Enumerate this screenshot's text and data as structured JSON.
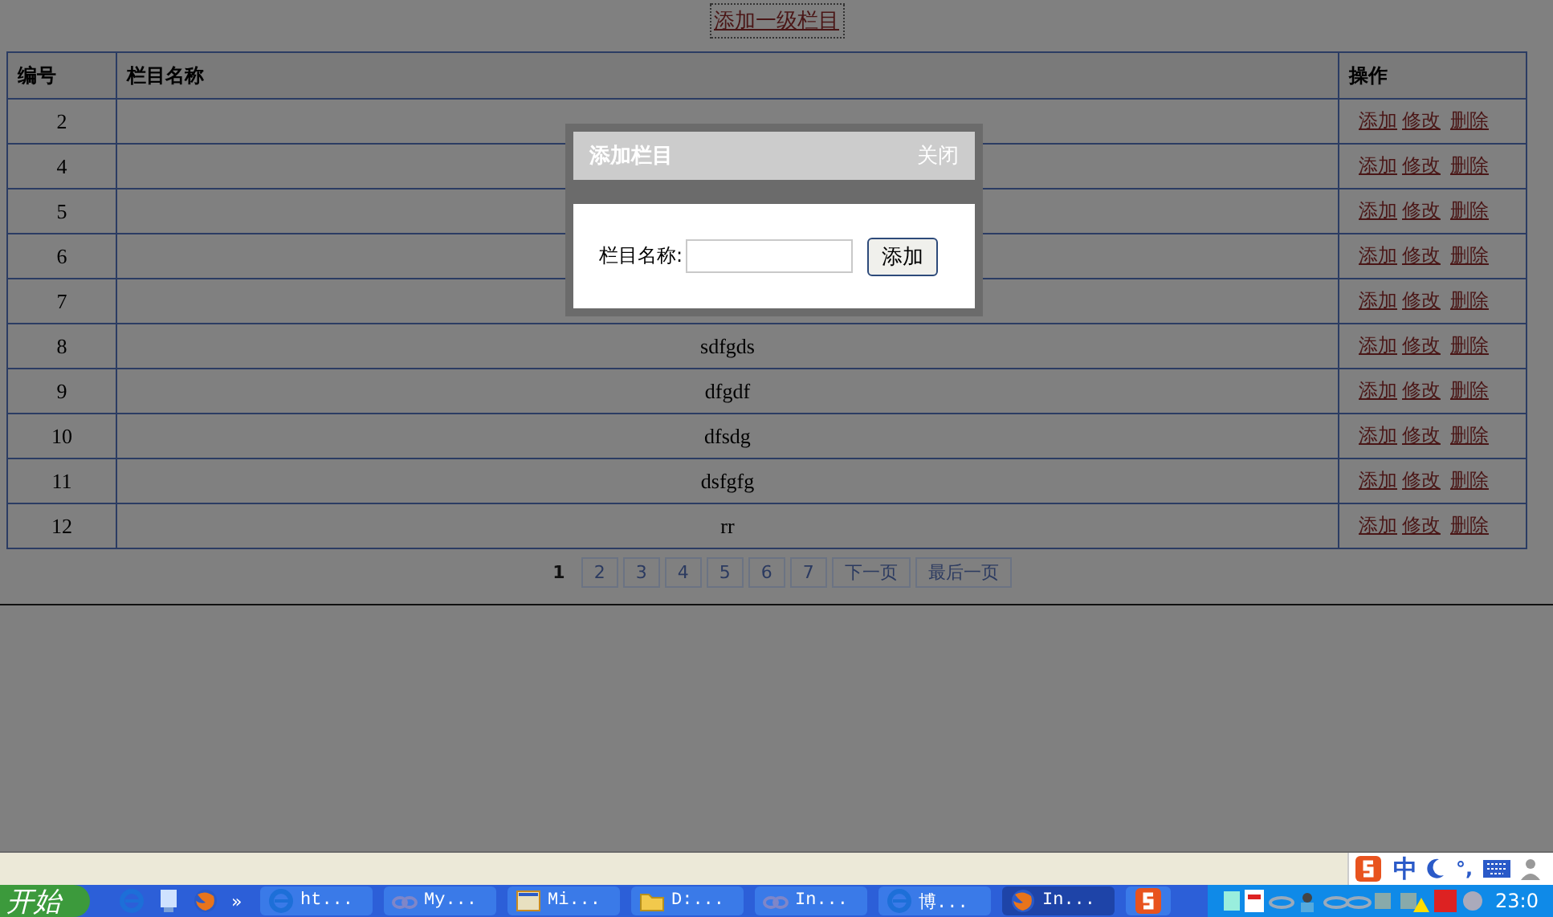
{
  "top_link": "添加一级栏目",
  "table": {
    "columns": [
      "编号",
      "栏目名称",
      "操作"
    ],
    "rows": [
      {
        "id": "2",
        "actions": [
          "添加",
          "修改",
          "删除"
        ]
      },
      {
        "id": "4",
        "actions": [
          "添加",
          "修改",
          "删除"
        ]
      },
      {
        "id": "5",
        "actions": [
          "添加",
          "修改",
          "删除"
        ]
      },
      {
        "id": "6",
        "actions": [
          "添加",
          "修改",
          "删除"
        ]
      },
      {
        "id": "7",
        "actions": [
          "添加",
          "修改",
          "删除"
        ]
      },
      {
        "id": "8",
        "name": "sdfgds",
        "actions": [
          "添加",
          "修改",
          "删除"
        ]
      },
      {
        "id": "9",
        "name": "dfgdf",
        "actions": [
          "添加",
          "修改",
          "删除"
        ]
      },
      {
        "id": "10",
        "name": "dfsdg",
        "actions": [
          "添加",
          "修改",
          "删除"
        ]
      },
      {
        "id": "11",
        "name": "dsfgfg",
        "actions": [
          "添加",
          "修改",
          "删除"
        ]
      },
      {
        "id": "12",
        "name": "rr",
        "actions": [
          "添加",
          "修改",
          "删除"
        ]
      }
    ]
  },
  "pagination": [
    {
      "label": "1",
      "selected": true
    },
    {
      "label": "2",
      "selected": false
    },
    {
      "label": "3",
      "selected": false
    },
    {
      "label": "4",
      "selected": false
    },
    {
      "label": "5",
      "selected": false
    },
    {
      "label": "6",
      "selected": false
    },
    {
      "label": "7",
      "selected": false
    },
    {
      "label": "下一页",
      "selected": false
    },
    {
      "label": "最后一页",
      "selected": false
    }
  ],
  "dialog": {
    "title": "添加栏目",
    "close": "关闭",
    "field_label": "栏目名称:",
    "button": "添加"
  },
  "ime_bar": {
    "mode": "中",
    "punctuation": "°,"
  },
  "taskbar": {
    "start": "开始",
    "quick_launch": [
      "»"
    ],
    "tasks": [
      {
        "label": "ht...",
        "kind": "ie",
        "selected": false
      },
      {
        "label": "My...",
        "kind": "link",
        "selected": false
      },
      {
        "label": "Mi...",
        "kind": "app",
        "selected": false
      },
      {
        "label": "D:...",
        "kind": "folder",
        "selected": false
      },
      {
        "label": "In...",
        "kind": "link",
        "selected": false
      },
      {
        "label": "博...",
        "kind": "ie",
        "selected": false
      },
      {
        "label": "In...",
        "kind": "firefox",
        "selected": true
      },
      {
        "kind": "sogou",
        "selected": false
      }
    ],
    "clock": "23:0"
  }
}
